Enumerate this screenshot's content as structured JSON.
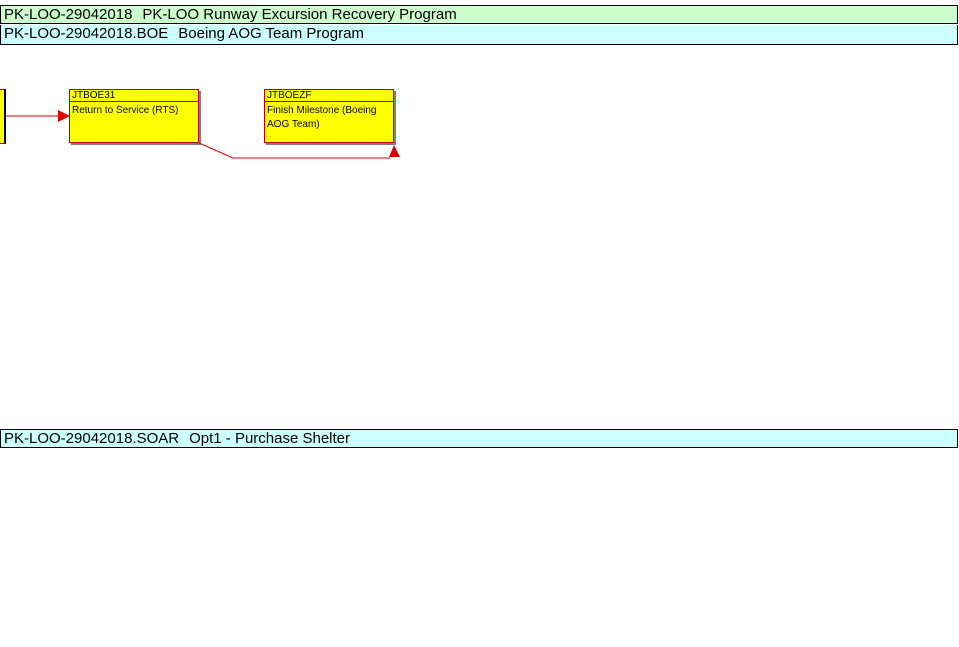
{
  "bands": {
    "project": {
      "code": "PK-LOO-29042018",
      "name": "PK-LOO Runway Excursion Recovery Program"
    },
    "wbs_boe": {
      "code": "PK-LOO-29042018.BOE",
      "name": "Boeing AOG Team Program"
    },
    "wbs_soar": {
      "code": "PK-LOO-29042018.SOAR",
      "name": "Opt1 - Purchase Shelter"
    }
  },
  "activities": [
    {
      "id": "JTBOE31",
      "name": "Return to Service (RTS)"
    },
    {
      "id": "JTBOEZF",
      "name": "Finish Milestone (Boeing AOG Team)"
    }
  ],
  "colors": {
    "project_band": "#ccffcc",
    "wbs_band": "#ccffff",
    "activity_fill": "#ffff00",
    "activity_border": "#c00000",
    "relationship_line": "#e00000"
  }
}
